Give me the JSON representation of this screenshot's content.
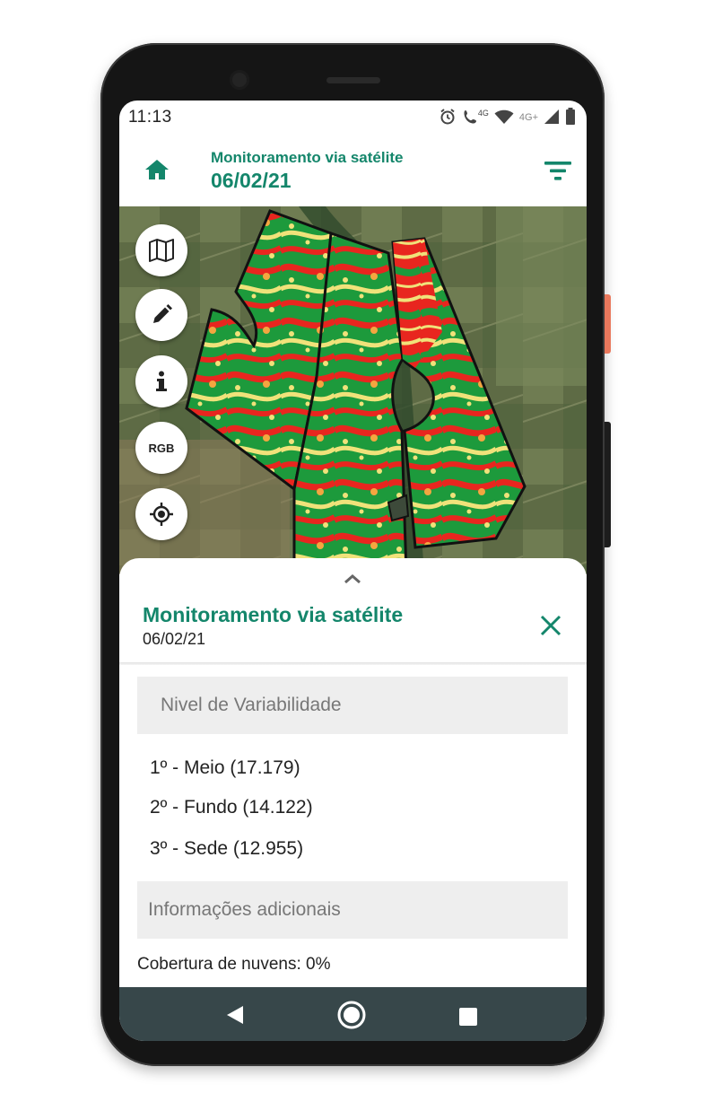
{
  "status_bar": {
    "time": "11:13",
    "network_label": "4G",
    "network_label_2": "4G+",
    "icons": [
      "alarm-icon",
      "volte-call-icon",
      "wifi-icon",
      "cell-signal-icon",
      "battery-icon"
    ]
  },
  "header": {
    "title": "Monitoramento via satélite",
    "date": "06/02/21",
    "home_icon": "home-icon",
    "filter_icon": "filter-icon"
  },
  "map_tools": {
    "buttons": [
      {
        "icon": "map-icon"
      },
      {
        "icon": "pencil-icon"
      },
      {
        "icon": "info-icon"
      },
      {
        "icon": "rgb-toggle",
        "label": "RGB"
      },
      {
        "icon": "gps-location-icon"
      }
    ]
  },
  "sheet": {
    "title": "Monitoramento via satélite",
    "date": "06/02/21",
    "variability_heading": "Nivel de Variabilidade",
    "rankings": [
      {
        "text": "1º - Meio (17.179)"
      },
      {
        "text": "2º - Fundo (14.122)"
      },
      {
        "text": "3º - Sede (12.955)"
      }
    ],
    "additional_heading": "Informações adicionais",
    "cloud_cover": "Cobertura de nuvens: 0%"
  },
  "colors": {
    "brand_green": "#14866b",
    "nav_bar": "#37474a",
    "ndvi_high": "#1a9a3a",
    "ndvi_low": "#e8261f",
    "ndvi_mid": "#f0e27a"
  }
}
